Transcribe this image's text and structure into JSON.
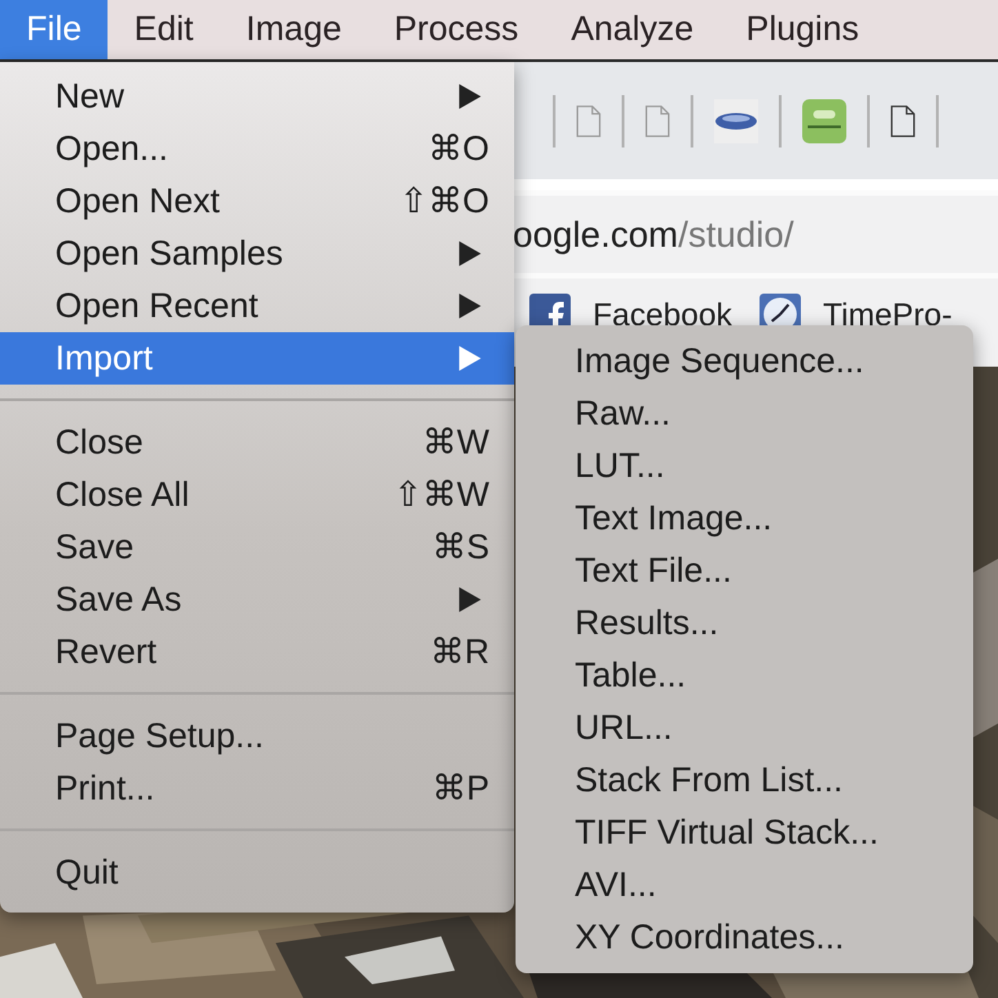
{
  "menubar": [
    {
      "label": "File",
      "selected": true
    },
    {
      "label": "Edit",
      "selected": false
    },
    {
      "label": "Image",
      "selected": false
    },
    {
      "label": "Process",
      "selected": false
    },
    {
      "label": "Analyze",
      "selected": false
    },
    {
      "label": "Plugins",
      "selected": false
    }
  ],
  "browser": {
    "url": {
      "host": "oogle.com",
      "path": "/studio/"
    },
    "bookmarks": [
      {
        "label": "Facebook",
        "kind": "facebook"
      },
      {
        "label": "TimePro-",
        "kind": "clock"
      }
    ]
  },
  "file_menu": [
    {
      "kind": "item",
      "label": "New",
      "has_submenu": true,
      "selected": false
    },
    {
      "kind": "item",
      "label": "Open...",
      "shortcut": "⌘O",
      "selected": false
    },
    {
      "kind": "item",
      "label": "Open Next",
      "shortcut": "⇧⌘O",
      "selected": false
    },
    {
      "kind": "item",
      "label": "Open Samples",
      "has_submenu": true,
      "selected": false
    },
    {
      "kind": "item",
      "label": "Open Recent",
      "has_submenu": true,
      "selected": false
    },
    {
      "kind": "item",
      "label": "Import",
      "has_submenu": true,
      "selected": true
    },
    {
      "kind": "separator"
    },
    {
      "kind": "item",
      "label": "Close",
      "shortcut": "⌘W",
      "selected": false
    },
    {
      "kind": "item",
      "label": "Close All",
      "shortcut": "⇧⌘W",
      "selected": false
    },
    {
      "kind": "item",
      "label": "Save",
      "shortcut": "⌘S",
      "selected": false
    },
    {
      "kind": "item",
      "label": "Save As",
      "has_submenu": true,
      "selected": false
    },
    {
      "kind": "item",
      "label": "Revert",
      "shortcut": "⌘R",
      "selected": false
    },
    {
      "kind": "separator"
    },
    {
      "kind": "item",
      "label": "Page Setup...",
      "selected": false
    },
    {
      "kind": "item",
      "label": "Print...",
      "shortcut": "⌘P",
      "selected": false
    },
    {
      "kind": "separator"
    },
    {
      "kind": "item",
      "label": "Quit",
      "selected": false
    }
  ],
  "import_submenu": [
    "Image Sequence...",
    "Raw...",
    "LUT...",
    "Text Image...",
    "Text File...",
    "Results...",
    "Table...",
    "URL...",
    "Stack From List...",
    "TIFF Virtual Stack...",
    "AVI...",
    "XY Coordinates..."
  ]
}
